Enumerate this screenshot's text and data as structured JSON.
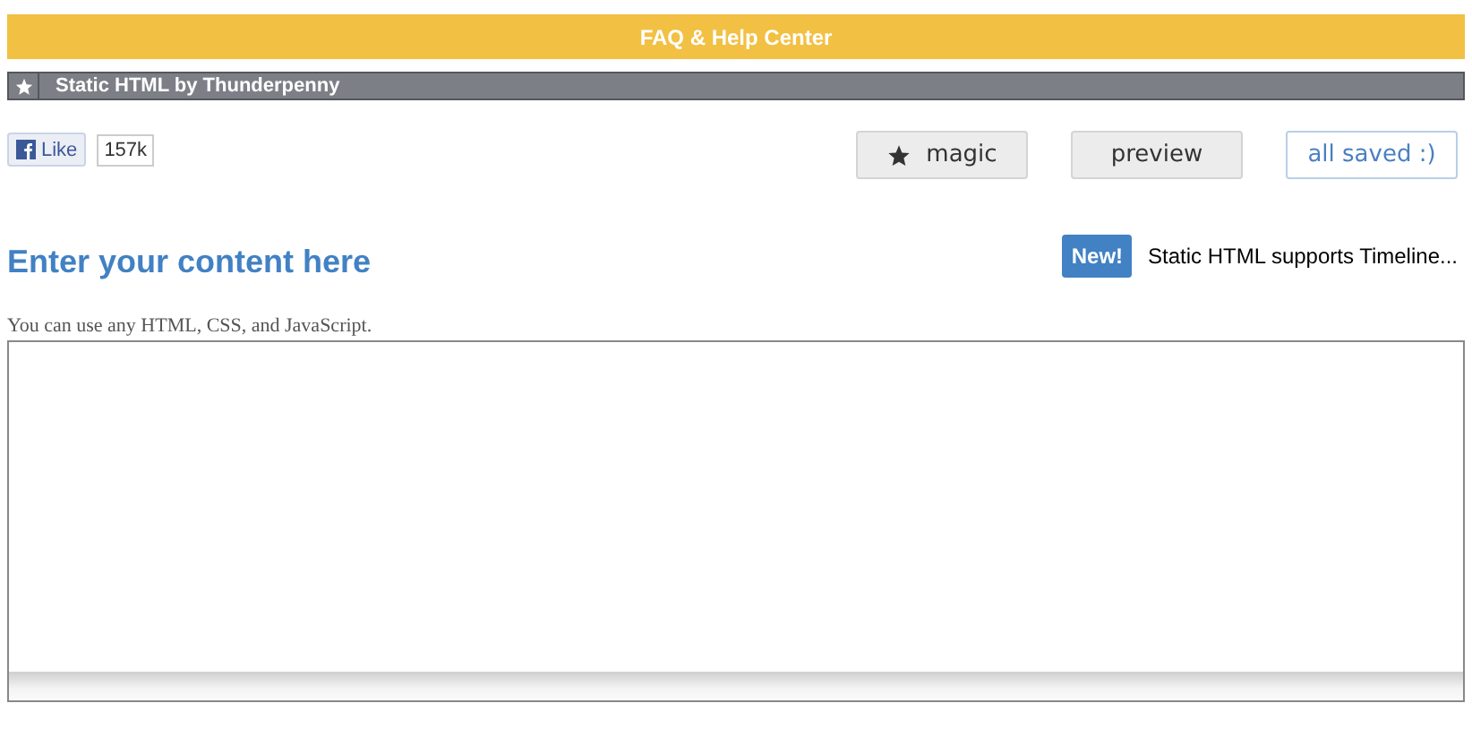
{
  "top_bar": {
    "label": "FAQ & Help Center"
  },
  "app_bar": {
    "title": "Static HTML by Thunderpenny"
  },
  "like": {
    "label": "Like",
    "count": "157k"
  },
  "buttons": [
    {
      "label": "magic",
      "kind": "icon"
    },
    {
      "label": "preview",
      "kind": "plain"
    },
    {
      "label": "all saved :)",
      "kind": "status"
    }
  ],
  "notice": {
    "badge": "New!",
    "text": "Static HTML supports Timeline..."
  },
  "heading": "Enter your content here",
  "hint": "You can use any HTML, CSS, and JavaScript."
}
